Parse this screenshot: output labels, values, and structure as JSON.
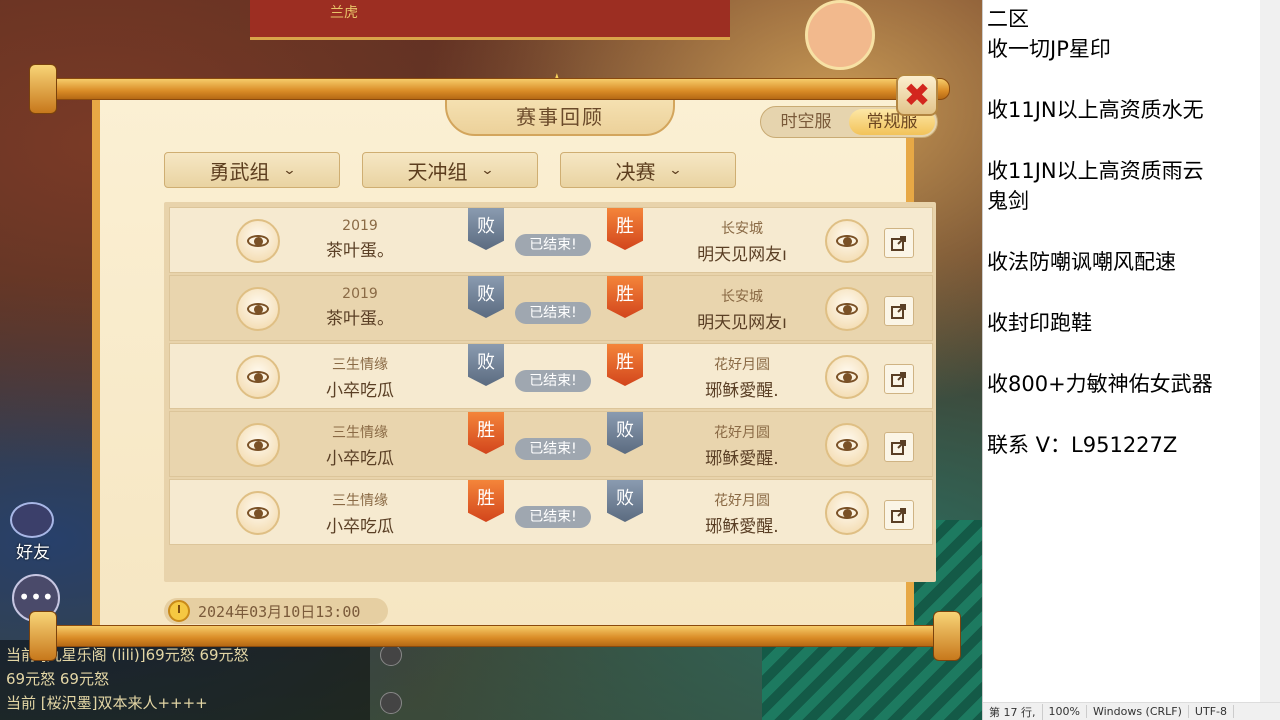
{
  "game_bg": {
    "top_sign": "兰虎"
  },
  "dialog": {
    "title": "赛事回顾",
    "server_toggle": [
      "时空服",
      "常规服"
    ],
    "close_icon": "✖",
    "filters": [
      {
        "label": "勇武组"
      },
      {
        "label": "天冲组"
      },
      {
        "label": "决赛"
      }
    ],
    "matches": [
      {
        "left_sub": "2019",
        "left_name": "茶叶蛋。",
        "left_result": "败",
        "status": "已结束!",
        "right_result": "胜",
        "right_sub": "长安城",
        "right_name": "明天见网友ı"
      },
      {
        "left_sub": "2019",
        "left_name": "茶叶蛋。",
        "left_result": "败",
        "status": "已结束!",
        "right_result": "胜",
        "right_sub": "长安城",
        "right_name": "明天见网友ı"
      },
      {
        "left_sub": "三生情缘",
        "left_name": "小卒吃瓜",
        "left_result": "败",
        "status": "已结束!",
        "right_result": "胜",
        "right_sub": "花好月圆",
        "right_name": "琊稣愛醒."
      },
      {
        "left_sub": "三生情缘",
        "left_name": "小卒吃瓜",
        "left_result": "胜",
        "status": "已结束!",
        "right_result": "败",
        "right_sub": "花好月圆",
        "right_name": "琊稣愛醒."
      },
      {
        "left_sub": "三生情缘",
        "left_name": "小卒吃瓜",
        "left_result": "胜",
        "status": "已结束!",
        "right_result": "败",
        "right_sub": "花好月圆",
        "right_name": "琊稣愛醒."
      }
    ],
    "timestamp": "2024年03月10日13:00"
  },
  "left_overlay": {
    "friend_label": "好友",
    "chat_lines": [
      "当前 [九星乐阁 (lili)]69元怒 69元怒",
      "69元怒  69元怒",
      "当前 [桜沢墨]双本来人++++"
    ]
  },
  "notepad": {
    "lines": [
      "二区",
      "收一切JP星印",
      "",
      "收11JN以上高资质水无",
      "",
      "收11JN以上高资质雨云",
      "鬼剑",
      "",
      "收法防嘲讽嘲风配速",
      "",
      "收封印跑鞋",
      "",
      "收800+力敏神佑女武器",
      "",
      "联系 V：L951227Z"
    ],
    "status": {
      "position": "第 17 行,",
      "zoom": "100%",
      "line_ending": "Windows (CRLF)",
      "encoding": "UTF-8"
    }
  },
  "colors": {
    "win": "#d2451c",
    "lose": "#5b6b80",
    "accent": "#e7a845"
  }
}
